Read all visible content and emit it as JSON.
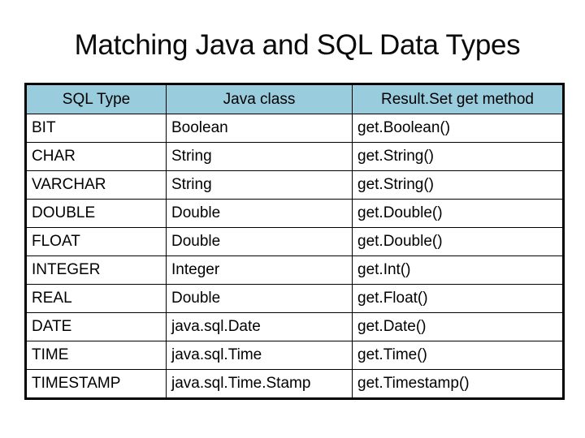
{
  "title": "Matching Java and SQL Data Types",
  "table": {
    "header_color": "#99cdde",
    "columns": [
      "SQL Type",
      "Java class",
      "Result.Set get method"
    ],
    "rows": [
      [
        "BIT",
        "Boolean",
        "get.Boolean()"
      ],
      [
        "CHAR",
        "String",
        "get.String()"
      ],
      [
        "VARCHAR",
        "String",
        "get.String()"
      ],
      [
        "DOUBLE",
        "Double",
        "get.Double()"
      ],
      [
        "FLOAT",
        "Double",
        "get.Double()"
      ],
      [
        "INTEGER",
        "Integer",
        "get.Int()"
      ],
      [
        "REAL",
        "Double",
        "get.Float()"
      ],
      [
        "DATE",
        "java.sql.Date",
        "get.Date()"
      ],
      [
        "TIME",
        "java.sql.Time",
        "get.Time()"
      ],
      [
        "TIMESTAMP",
        "java.sql.Time.Stamp",
        "get.Timestamp()"
      ]
    ]
  }
}
